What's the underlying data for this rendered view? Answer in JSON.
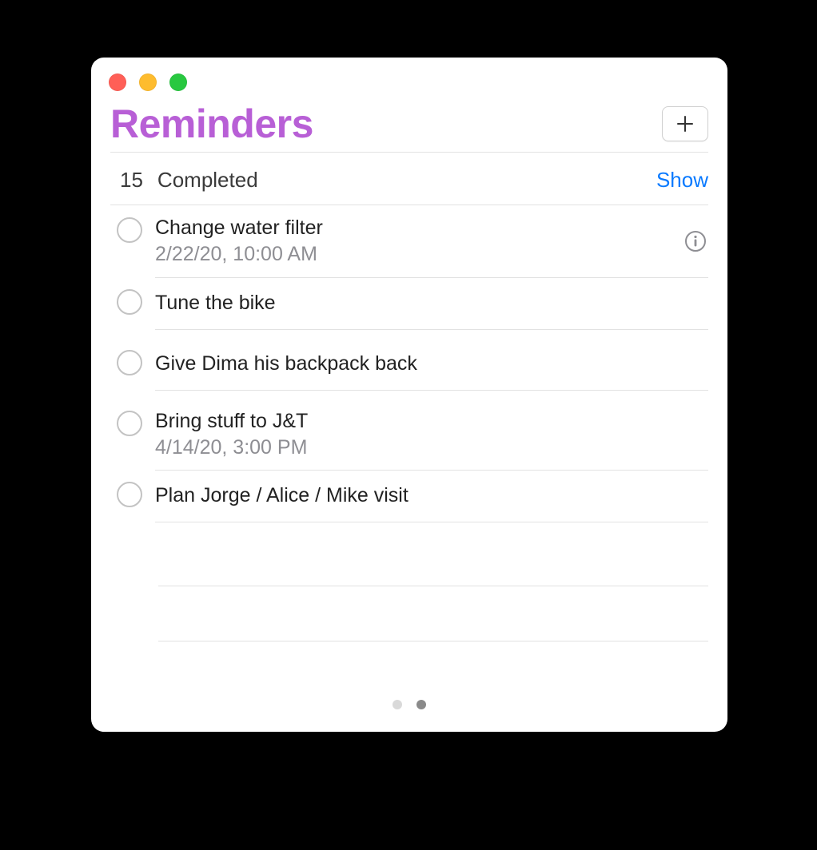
{
  "header": {
    "title": "Reminders",
    "add_icon": "plus-icon"
  },
  "subheader": {
    "completed_count": "15",
    "completed_label": "Completed",
    "show_label": "Show"
  },
  "reminders": [
    {
      "title": "Change water filter",
      "subtitle": "2/22/20, 10:00 AM",
      "show_info": true
    },
    {
      "title": "Tune the bike",
      "subtitle": "",
      "show_info": false
    },
    {
      "title": "Give Dima his backpack back",
      "subtitle": "",
      "show_info": false
    },
    {
      "title": "Bring stuff to J&T",
      "subtitle": "4/14/20, 3:00 PM",
      "show_info": false
    },
    {
      "title": "Plan Jorge / Alice / Mike visit",
      "subtitle": "",
      "show_info": false
    }
  ],
  "pager": {
    "page_count": 2,
    "active_index": 1
  }
}
